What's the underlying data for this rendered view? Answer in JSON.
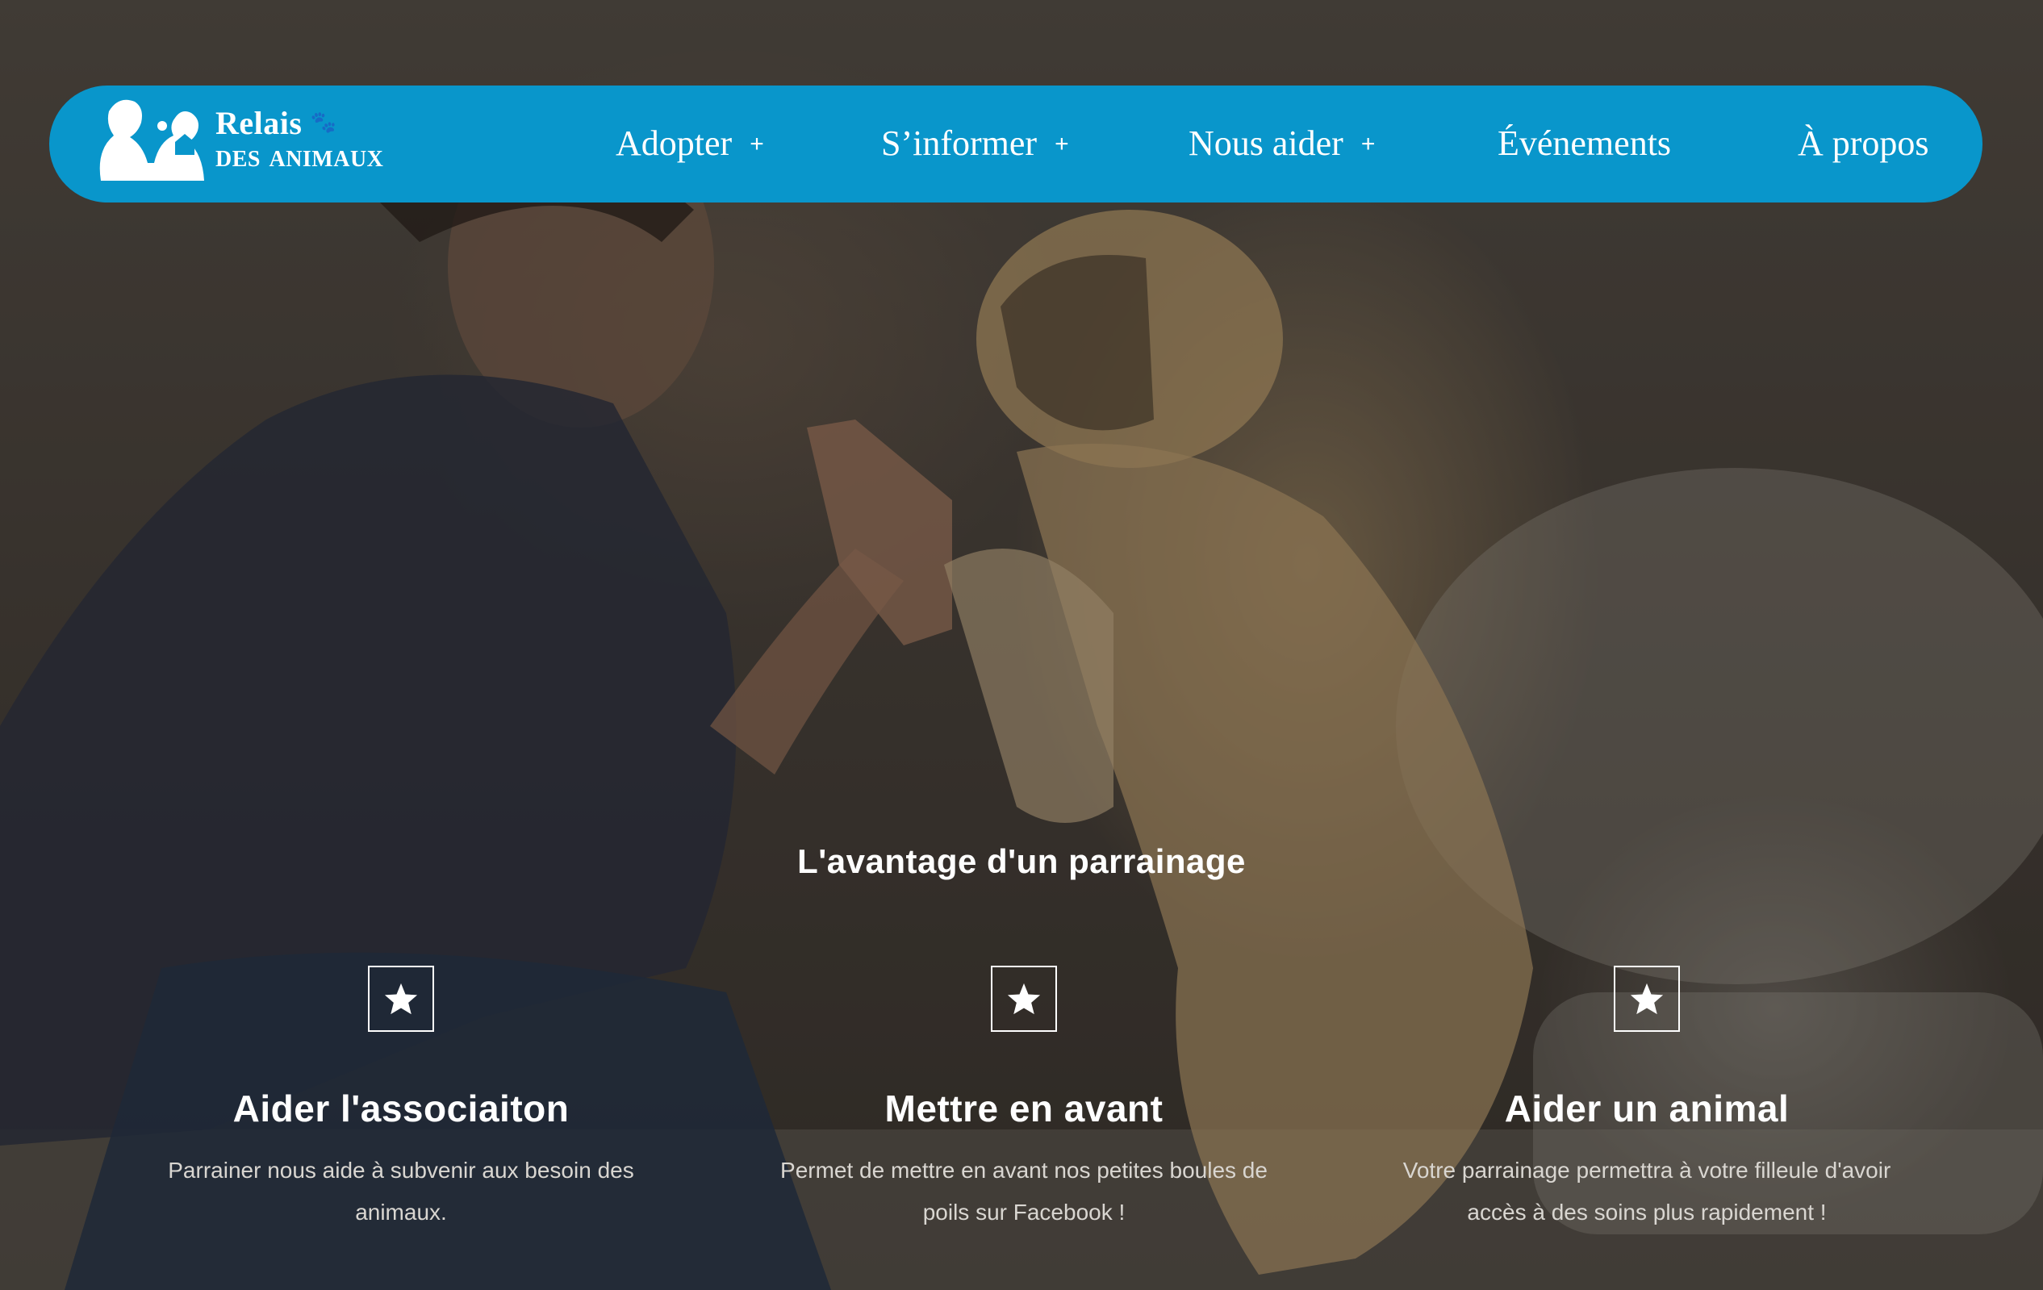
{
  "brand": {
    "line1": "Relais",
    "line2": "des animaux",
    "accent_color": "#0996cb"
  },
  "nav": {
    "items": [
      {
        "label": "Adopter",
        "has_submenu": true,
        "plus": "+"
      },
      {
        "label": "S’informer",
        "has_submenu": true,
        "plus": "+"
      },
      {
        "label": "Nous aider",
        "has_submenu": true,
        "plus": "+"
      },
      {
        "label": "Événements",
        "has_submenu": false
      },
      {
        "label": "À propos",
        "has_submenu": false
      }
    ]
  },
  "section": {
    "title": "L'avantage d'un parrainage",
    "features": [
      {
        "icon": "star-icon",
        "title": "Aider l'associaiton",
        "text": "Parrainer nous aide à subvenir aux besoin des animaux."
      },
      {
        "icon": "star-icon",
        "title": "Mettre en avant",
        "text": "Permet de mettre en avant nos petites boules de poils sur Facebook !"
      },
      {
        "icon": "star-icon",
        "title": "Aider un animal",
        "text": "Votre parrainage permettra à votre filleule d'avoir accès à des soins plus rapidement !"
      }
    ]
  }
}
